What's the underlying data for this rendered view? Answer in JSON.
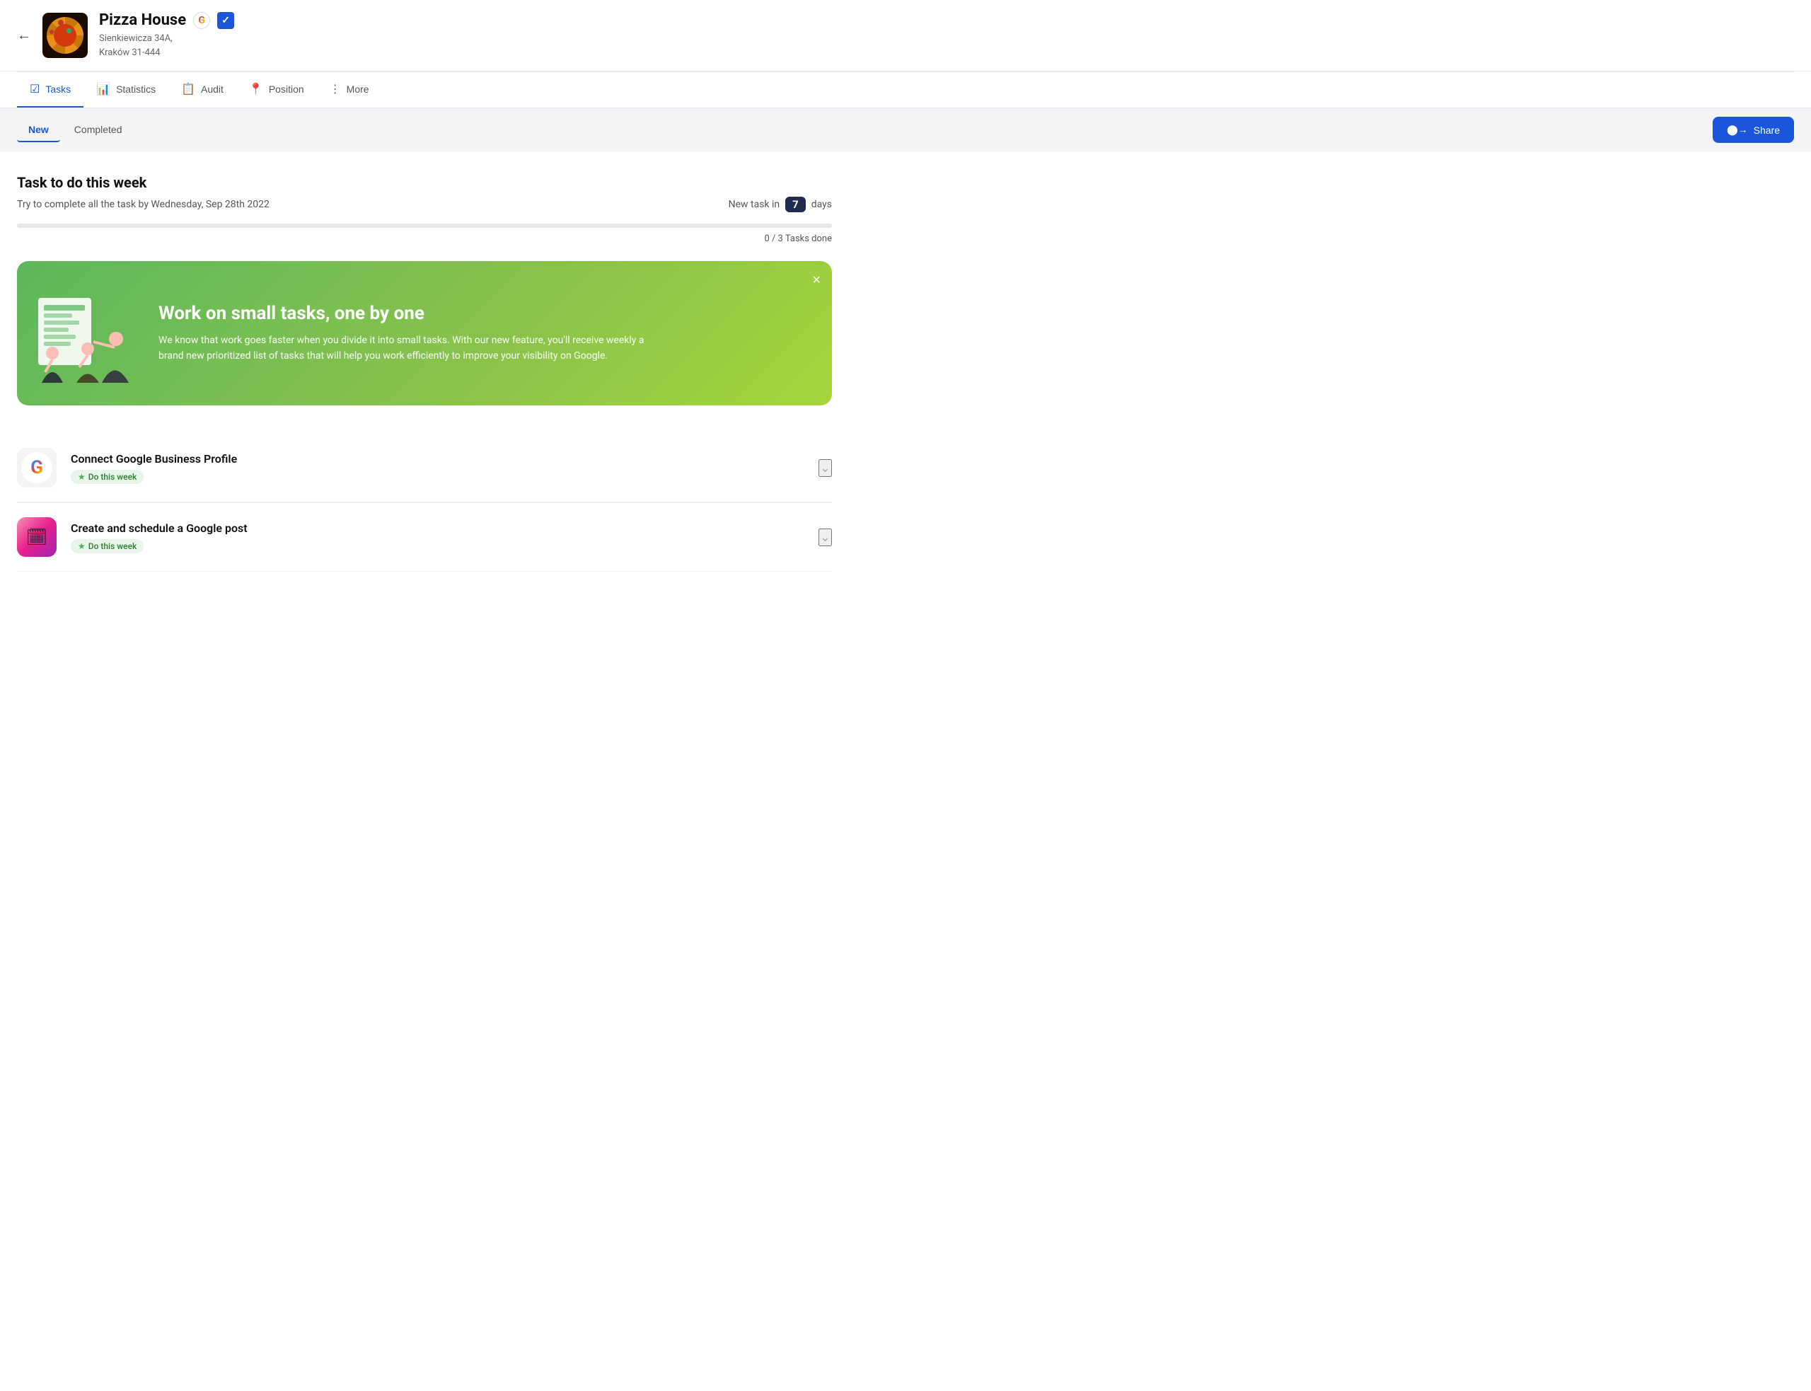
{
  "header": {
    "back_label": "←",
    "business_name": "Pizza House",
    "business_address_line1": "Sienkiewicza 34A,",
    "business_address_line2": "Kraków 31-444"
  },
  "nav": {
    "tabs": [
      {
        "id": "tasks",
        "label": "Tasks",
        "icon": "☑"
      },
      {
        "id": "statistics",
        "label": "Statistics",
        "icon": "📊"
      },
      {
        "id": "audit",
        "label": "Audit",
        "icon": "📋"
      },
      {
        "id": "position",
        "label": "Position",
        "icon": "📍"
      },
      {
        "id": "more",
        "label": "More",
        "icon": "⋮"
      }
    ]
  },
  "filter": {
    "tabs": [
      {
        "id": "new",
        "label": "New"
      },
      {
        "id": "completed",
        "label": "Completed"
      }
    ],
    "share_label": "Share"
  },
  "week_task": {
    "title": "Task to do this week",
    "subtitle": "Try to complete all the task by Wednesday, Sep 28th 2022",
    "new_task_label": "New task in",
    "days": "7",
    "days_suffix": "days",
    "progress_percent": 0,
    "tasks_done": "0 / 3 Tasks done"
  },
  "promo_banner": {
    "title": "Work on small tasks, one by one",
    "description": "We know that work goes faster when you divide it into small tasks. With our new feature, you'll receive weekly a brand new prioritized list of tasks that will help you work efficiently to improve your visibility on Google.",
    "close_label": "×"
  },
  "tasks": [
    {
      "id": "connect-google",
      "title": "Connect Google Business Profile",
      "badge": "Do this week",
      "icon_type": "google"
    },
    {
      "id": "google-post",
      "title": "Create and schedule a Google post",
      "badge": "Do this week",
      "icon_type": "post"
    }
  ]
}
